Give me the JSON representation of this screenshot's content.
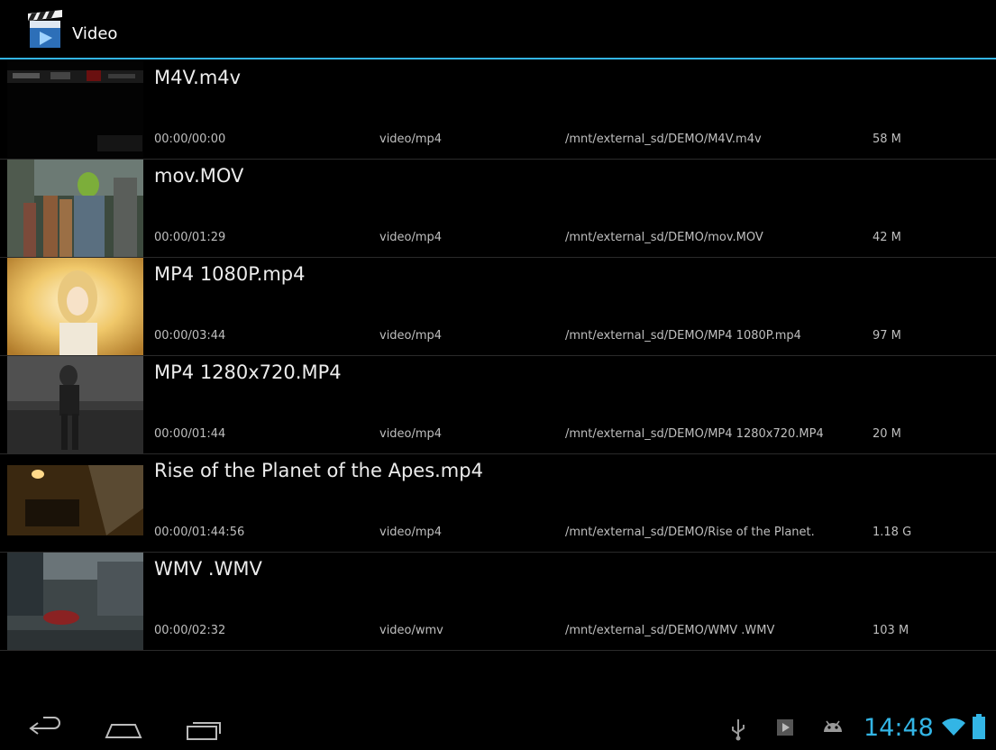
{
  "action_bar": {
    "title": "Video",
    "icon": "video-clapper-icon"
  },
  "videos": [
    {
      "title": "M4V.m4v",
      "duration": "00:00/00:00",
      "mime": "video/mp4",
      "path": "/mnt/external_sd/DEMO/M4V.m4v",
      "size": "58 M"
    },
    {
      "title": "mov.MOV",
      "duration": "00:00/01:29",
      "mime": "video/mp4",
      "path": "/mnt/external_sd/DEMO/mov.MOV",
      "size": "42 M"
    },
    {
      "title": "MP4 1080P.mp4",
      "duration": "00:00/03:44",
      "mime": "video/mp4",
      "path": "/mnt/external_sd/DEMO/MP4 1080P.mp4",
      "size": "97 M"
    },
    {
      "title": "MP4 1280x720.MP4",
      "duration": "00:00/01:44",
      "mime": "video/mp4",
      "path": "/mnt/external_sd/DEMO/MP4 1280x720.MP4",
      "size": "20 M"
    },
    {
      "title": "Rise of the Planet of the Apes.mp4",
      "duration": "00:00/01:44:56",
      "mime": "video/mp4",
      "path": "/mnt/external_sd/DEMO/Rise of the Planet.",
      "size": "1.18 G"
    },
    {
      "title": "WMV .WMV",
      "duration": "00:00/02:32",
      "mime": "video/wmv",
      "path": "/mnt/external_sd/DEMO/WMV .WMV",
      "size": "103 M"
    }
  ],
  "nav_bar": {
    "buttons": [
      "back-icon",
      "home-icon",
      "recent-apps-icon"
    ],
    "status_icons": [
      "usb-icon",
      "media-play-icon",
      "android-debug-icon",
      "wifi-icon",
      "battery-icon"
    ],
    "clock": "14:48"
  },
  "colors": {
    "accent": "#33b5e5",
    "background": "#000000",
    "divider": "#2a2a2a"
  }
}
